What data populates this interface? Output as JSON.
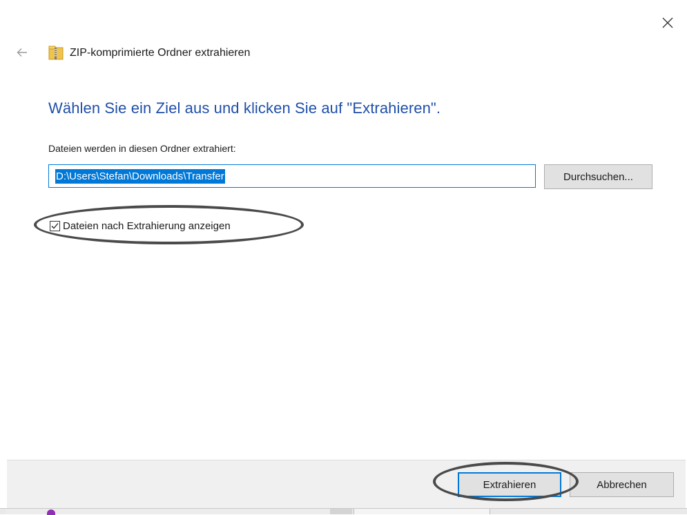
{
  "window": {
    "title": "ZIP-komprimierte Ordner extrahieren",
    "close_icon": "close-icon",
    "back_icon": "back-arrow-icon",
    "app_icon": "zip-folder-icon"
  },
  "main": {
    "heading": "Wählen Sie ein Ziel aus und klicken Sie auf \"Extrahieren\".",
    "folder_label": "Dateien werden in diesen Ordner extrahiert:",
    "path_value": "D:\\Users\\Stefan\\Downloads\\Transfer",
    "browse_label": "Durchsuchen...",
    "show_files_label": "Dateien nach Extrahierung anzeigen",
    "show_files_checked": true
  },
  "footer": {
    "extract_label": "Extrahieren",
    "cancel_label": "Abbrechen"
  },
  "colors": {
    "accent": "#0078d7",
    "heading": "#1f4fa8",
    "footer_bg": "#f0f0f0",
    "annotation": "#4a4a4a"
  }
}
